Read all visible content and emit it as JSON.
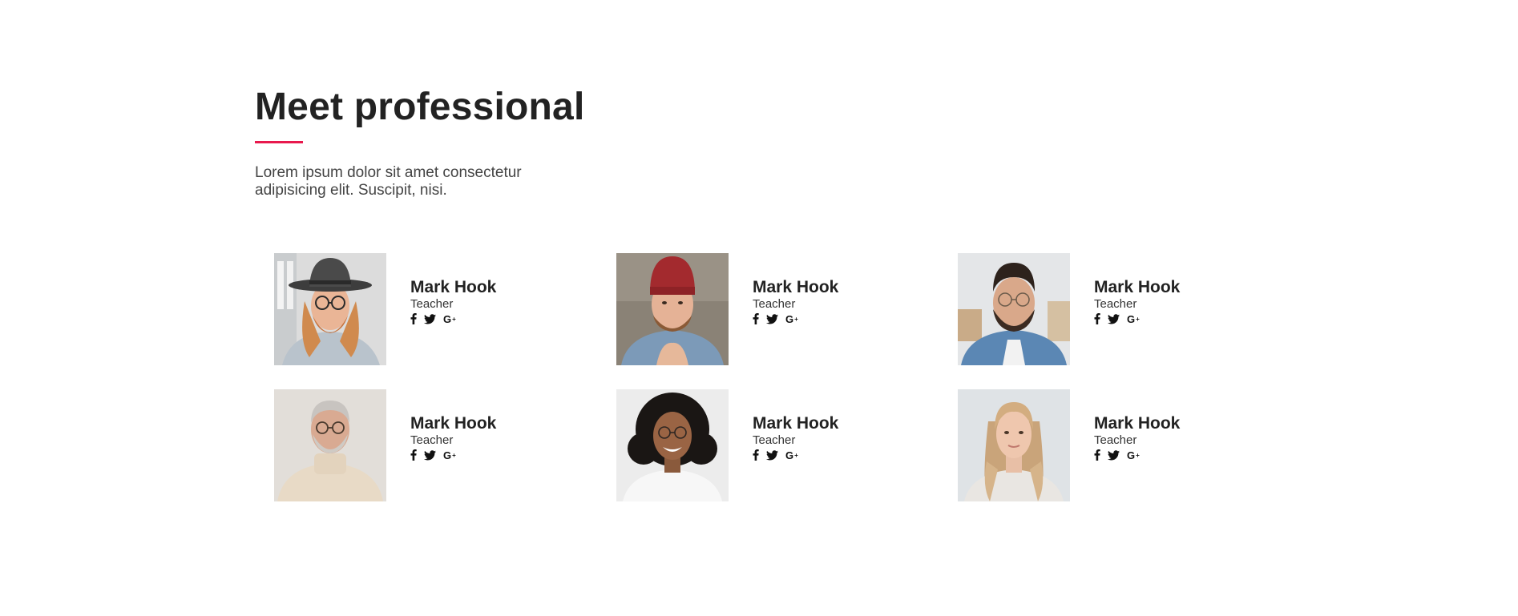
{
  "header": {
    "title": "Meet professional",
    "accent_color": "#e8194d",
    "intro": "Lorem ipsum dolor sit amet consectetur adipisicing elit. Suscipit, nisi."
  },
  "team": [
    {
      "name": "Mark Hook",
      "role": "Teacher",
      "photo": "man-with-hat-and-glasses",
      "socials": [
        "facebook-icon",
        "twitter-icon",
        "google-plus-icon"
      ]
    },
    {
      "name": "Mark Hook",
      "role": "Teacher",
      "photo": "man-with-red-beanie",
      "socials": [
        "facebook-icon",
        "twitter-icon",
        "google-plus-icon"
      ]
    },
    {
      "name": "Mark Hook",
      "role": "Teacher",
      "photo": "man-with-glasses-denim-shirt",
      "socials": [
        "facebook-icon",
        "twitter-icon",
        "google-plus-icon"
      ]
    },
    {
      "name": "Mark Hook",
      "role": "Teacher",
      "photo": "older-man-turtleneck",
      "socials": [
        "facebook-icon",
        "twitter-icon",
        "google-plus-icon"
      ]
    },
    {
      "name": "Mark Hook",
      "role": "Teacher",
      "photo": "woman-curly-hair-glasses",
      "socials": [
        "facebook-icon",
        "twitter-icon",
        "google-plus-icon"
      ]
    },
    {
      "name": "Mark Hook",
      "role": "Teacher",
      "photo": "woman-long-blonde-hair",
      "socials": [
        "facebook-icon",
        "twitter-icon",
        "google-plus-icon"
      ]
    }
  ],
  "social_labels": {
    "google_plus": "G"
  }
}
